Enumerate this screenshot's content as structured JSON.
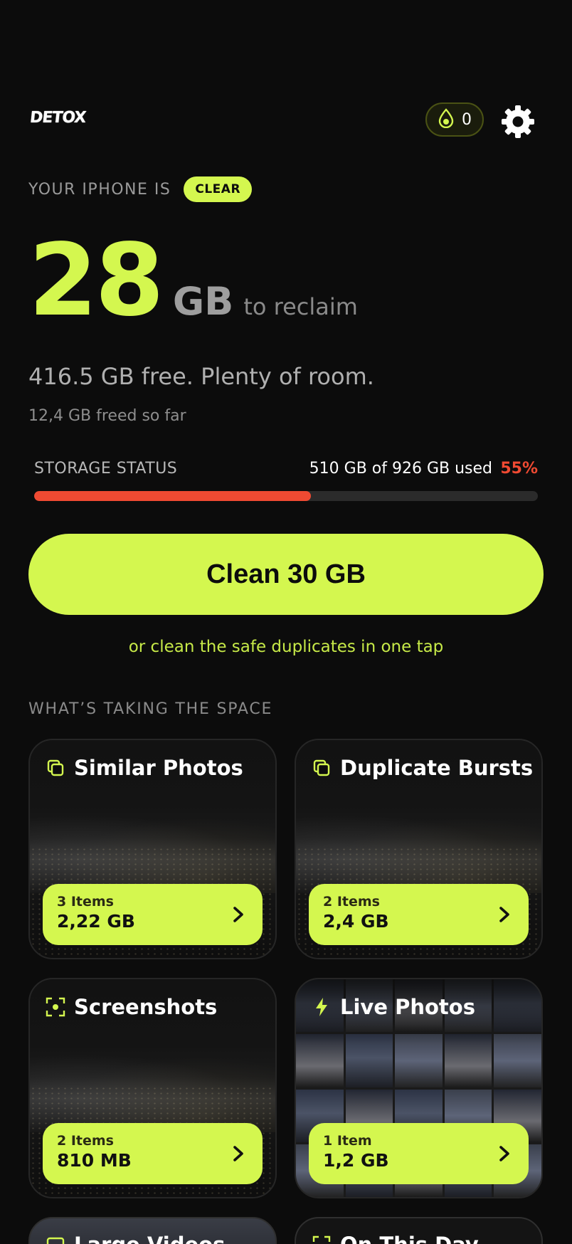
{
  "header": {
    "logo_text": "DETOX",
    "drops_count": "0",
    "icons": {
      "drop": "drop-icon",
      "settings": "gear-icon"
    }
  },
  "status": {
    "label": "YOUR IPHONE IS",
    "badge": "CLEAR"
  },
  "reclaim": {
    "amount": "28",
    "unit": "GB",
    "suffix": "to reclaim"
  },
  "free_text": "416.5 GB free. Plenty of room.",
  "freed_text": "12,4 GB freed so far",
  "storage": {
    "label": "STORAGE STATUS",
    "used_text": "510 GB of 926 GB used",
    "percent_text": "55%",
    "percent_value": 55
  },
  "clean_button": "Clean 30 GB",
  "alt_link": "or clean the safe duplicates in one tap",
  "section_title": "WHAT’S TAKING THE SPACE",
  "categories": [
    {
      "title": "Similar Photos",
      "count": "3 Items",
      "size": "2,22 GB",
      "icon": "copy-icon"
    },
    {
      "title": "Duplicate Bursts",
      "count": "2 Items",
      "size": "2,4 GB",
      "icon": "copy-icon"
    },
    {
      "title": "Screenshots",
      "count": "2 Items",
      "size": "810 MB",
      "icon": "screenshot-icon"
    },
    {
      "title": "Live Photos",
      "count": "1 Item",
      "size": "1,2 GB",
      "icon": "bolt-icon"
    },
    {
      "title": "Large Videos",
      "icon": "video-icon"
    },
    {
      "title": "On This Day",
      "icon": "calendar-icon"
    }
  ],
  "colors": {
    "accent": "#d4f74f",
    "danger": "#ef4a32",
    "background": "#0c0c0c"
  }
}
